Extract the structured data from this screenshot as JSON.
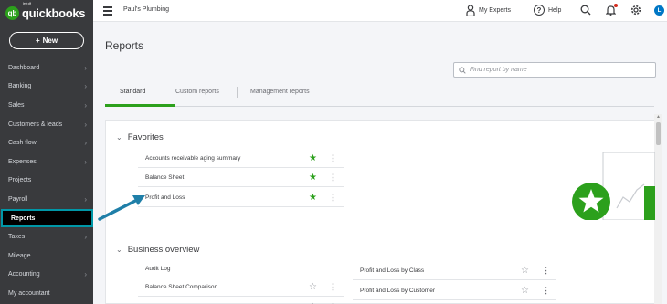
{
  "brand": {
    "badge": "qb",
    "intuit": "intuit",
    "name": "quickbooks"
  },
  "new_button": {
    "plus": "+",
    "label": "New"
  },
  "nav": [
    {
      "label": "Dashboard",
      "chevron": true
    },
    {
      "label": "Banking",
      "chevron": true
    },
    {
      "label": "Sales",
      "chevron": true
    },
    {
      "label": "Customers & leads",
      "chevron": true
    },
    {
      "label": "Cash flow",
      "chevron": true
    },
    {
      "label": "Expenses",
      "chevron": true
    },
    {
      "label": "Projects",
      "chevron": false
    },
    {
      "label": "Payroll",
      "chevron": true
    },
    {
      "label": "Reports",
      "chevron": false,
      "active": true
    },
    {
      "label": "Taxes",
      "chevron": true
    },
    {
      "label": "Mileage",
      "chevron": false
    },
    {
      "label": "Accounting",
      "chevron": true
    },
    {
      "label": "My accountant",
      "chevron": false
    }
  ],
  "topbar": {
    "company": "Paul's Plumbing",
    "my_experts": "My Experts",
    "help_icon": "?",
    "help": "Help",
    "user_initial": "L"
  },
  "page": {
    "title": "Reports",
    "search_placeholder": "Find report by name",
    "tabs": [
      "Standard",
      "Custom reports",
      "Management reports"
    ]
  },
  "favorites": {
    "title": "Favorites",
    "rows": [
      {
        "name": "Accounts receivable aging summary",
        "favorite": true
      },
      {
        "name": "Balance Sheet",
        "favorite": true
      },
      {
        "name": "Profit and Loss",
        "favorite": true
      }
    ]
  },
  "business_overview": {
    "title": "Business overview",
    "left": [
      {
        "name": "Audit Log",
        "favorite": null
      },
      {
        "name": "Balance Sheet Comparison",
        "favorite": false
      }
    ],
    "right": [
      {
        "name": "Profit and Loss by Class",
        "favorite": false
      },
      {
        "name": "Profit and Loss by Customer",
        "favorite": false
      }
    ]
  },
  "colors": {
    "sidebar": "#393a3d",
    "accent": "#2ca01c",
    "highlight": "#0097a7",
    "arrow": "#1f7fa8"
  }
}
